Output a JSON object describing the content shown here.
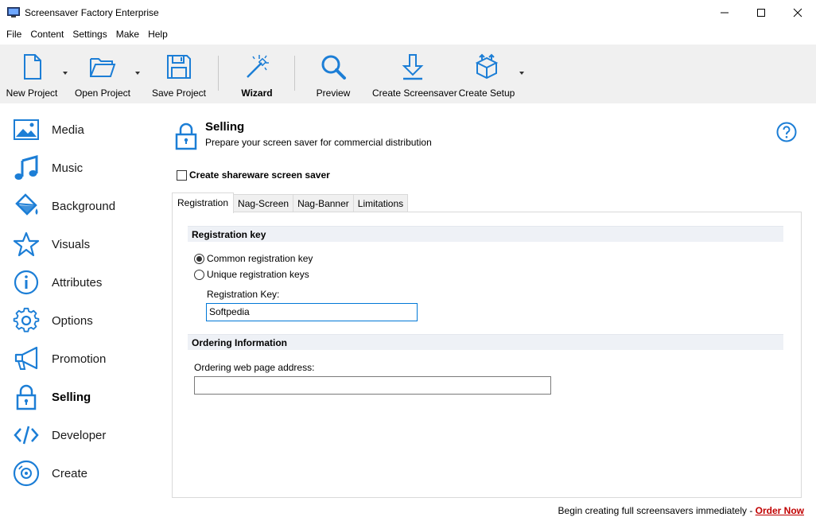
{
  "window": {
    "title": "Screensaver Factory Enterprise"
  },
  "menu": [
    "File",
    "Content",
    "Settings",
    "Make",
    "Help"
  ],
  "toolbar": {
    "new_project": "New Project",
    "open_project": "Open Project",
    "save_project": "Save Project",
    "wizard": "Wizard",
    "preview": "Preview",
    "create_screensaver": "Create Screensaver",
    "create_setup": "Create Setup"
  },
  "sidebar": {
    "items": [
      {
        "label": "Media",
        "icon": "image-icon"
      },
      {
        "label": "Music",
        "icon": "music-note-icon"
      },
      {
        "label": "Background",
        "icon": "paint-bucket-icon"
      },
      {
        "label": "Visuals",
        "icon": "star-icon"
      },
      {
        "label": "Attributes",
        "icon": "info-icon"
      },
      {
        "label": "Options",
        "icon": "gear-icon"
      },
      {
        "label": "Promotion",
        "icon": "megaphone-icon"
      },
      {
        "label": "Selling",
        "icon": "lock-icon",
        "active": true
      },
      {
        "label": "Developer",
        "icon": "code-icon"
      },
      {
        "label": "Create",
        "icon": "disc-icon"
      }
    ]
  },
  "header": {
    "title": "Selling",
    "subtitle": "Prepare your screen saver for commercial distribution"
  },
  "shareware": {
    "label": "Create shareware screen saver",
    "checked": false
  },
  "tabs": [
    "Registration",
    "Nag-Screen",
    "Nag-Banner",
    "Limitations"
  ],
  "registration": {
    "group_title": "Registration key",
    "option_common": "Common registration key",
    "option_unique": "Unique registration keys",
    "selected": "common",
    "key_label": "Registration Key:",
    "key_value": "Softpedia"
  },
  "ordering": {
    "group_title": "Ordering Information",
    "address_label": "Ordering web page address:",
    "address_value": ""
  },
  "footer": {
    "text": "Begin creating full screensavers immediately - ",
    "link": "Order Now"
  },
  "colors": {
    "accent": "#1c7ed6",
    "link": "#c00000",
    "group_bg": "#eef1f6"
  }
}
